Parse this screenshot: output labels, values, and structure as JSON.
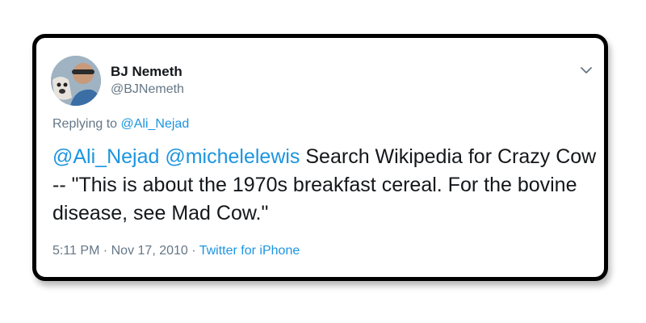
{
  "tweet": {
    "author_name": "BJ Nemeth",
    "author_handle": "@BJNemeth",
    "replying_prefix": "Replying to ",
    "replying_handle": "@Ali_Nejad",
    "mention_1": "@Ali_Nejad",
    "mention_2": "@michelelewis",
    "body": " Search Wikipedia for Crazy Cow -- \"This is about the 1970s breakfast cereal. For the bovine disease, see Mad Cow.\"",
    "time": "5:11 PM · Nov 17, 2010",
    "separator": " · ",
    "source": "Twitter for iPhone"
  },
  "icons": {
    "menu": "chevron-down-icon",
    "avatar": "avatar"
  },
  "colors": {
    "link": "#1b95e0",
    "secondary_text": "#657786",
    "primary_text": "#14171a"
  }
}
